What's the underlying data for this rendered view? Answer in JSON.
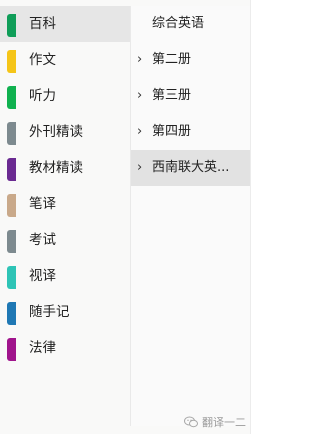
{
  "sections": [
    {
      "label": "百科",
      "color": "#0f9d58",
      "selected": true
    },
    {
      "label": "作文",
      "color": "#f5c518"
    },
    {
      "label": "听力",
      "color": "#10b14f"
    },
    {
      "label": "外刊精读",
      "color": "#7d8a8f"
    },
    {
      "label": "教材精读",
      "color": "#6a2a91"
    },
    {
      "label": "笔译",
      "color": "#c9a98a"
    },
    {
      "label": "考试",
      "color": "#7d8a8f"
    },
    {
      "label": "视译",
      "color": "#2ec4b6"
    },
    {
      "label": "随手记",
      "color": "#1f78b4"
    },
    {
      "label": "法律",
      "color": "#a0148c"
    }
  ],
  "pages": [
    {
      "label": "综合英语",
      "chevron": false
    },
    {
      "label": "第二册",
      "chevron": true
    },
    {
      "label": "第三册",
      "chevron": true
    },
    {
      "label": "第四册",
      "chevron": true
    },
    {
      "label": "西南联大英...",
      "chevron": true,
      "selected": true
    }
  ],
  "chevron_glyph": "›",
  "watermark": {
    "text": "翻译一二",
    "icon": "wechat-icon"
  }
}
